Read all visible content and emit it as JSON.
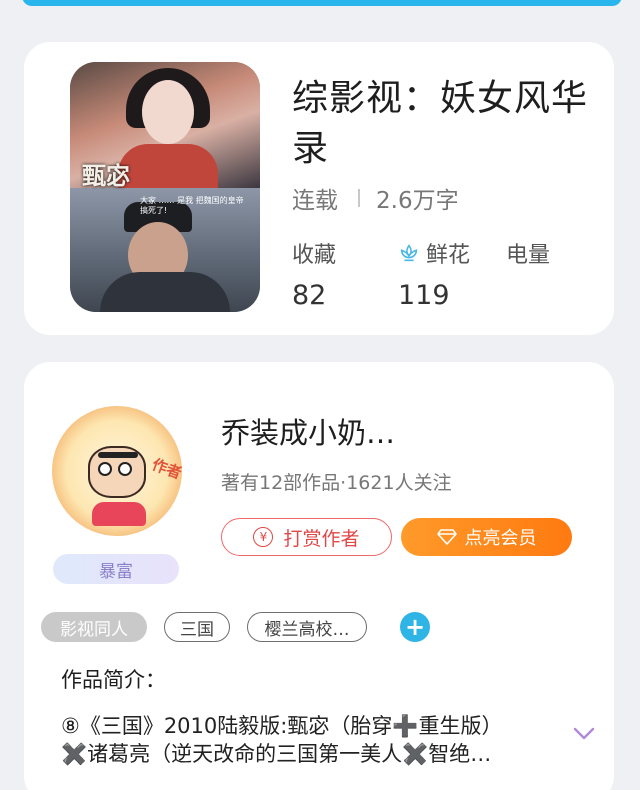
{
  "book": {
    "title": "综影视：妖女风华录",
    "cover_title_text": "甄宓",
    "cover_caption_text": "大家 …… 是我 把魏国的皇帝 搞死了!",
    "status": "连载",
    "word_count": "2.6万字",
    "stats": {
      "favorites_label": "收藏",
      "favorites_value": "82",
      "flowers_label": "鲜花",
      "flowers_value": "119",
      "power_label": "电量"
    }
  },
  "author": {
    "avatar_badge": "作者",
    "tag": "暴富",
    "name": "乔装成小奶…",
    "meta": "著有12部作品·1621人关注",
    "reward_button": "打赏作者",
    "reward_icon": "¥",
    "vip_button": "点亮会员"
  },
  "tags": [
    "影视同人",
    "三国",
    "樱兰高校…"
  ],
  "intro": {
    "label": "作品简介：",
    "line1": "⑧《三国》2010陆毅版:甄宓（胎穿➕重生版）",
    "line2": "✖️诸葛亮（逆天改命的三国第一美人✖️智绝…"
  },
  "colors": {
    "accent_blue": "#2fb4e6",
    "vip_orange": "#ff8a1c",
    "reward_red": "#e04848"
  }
}
